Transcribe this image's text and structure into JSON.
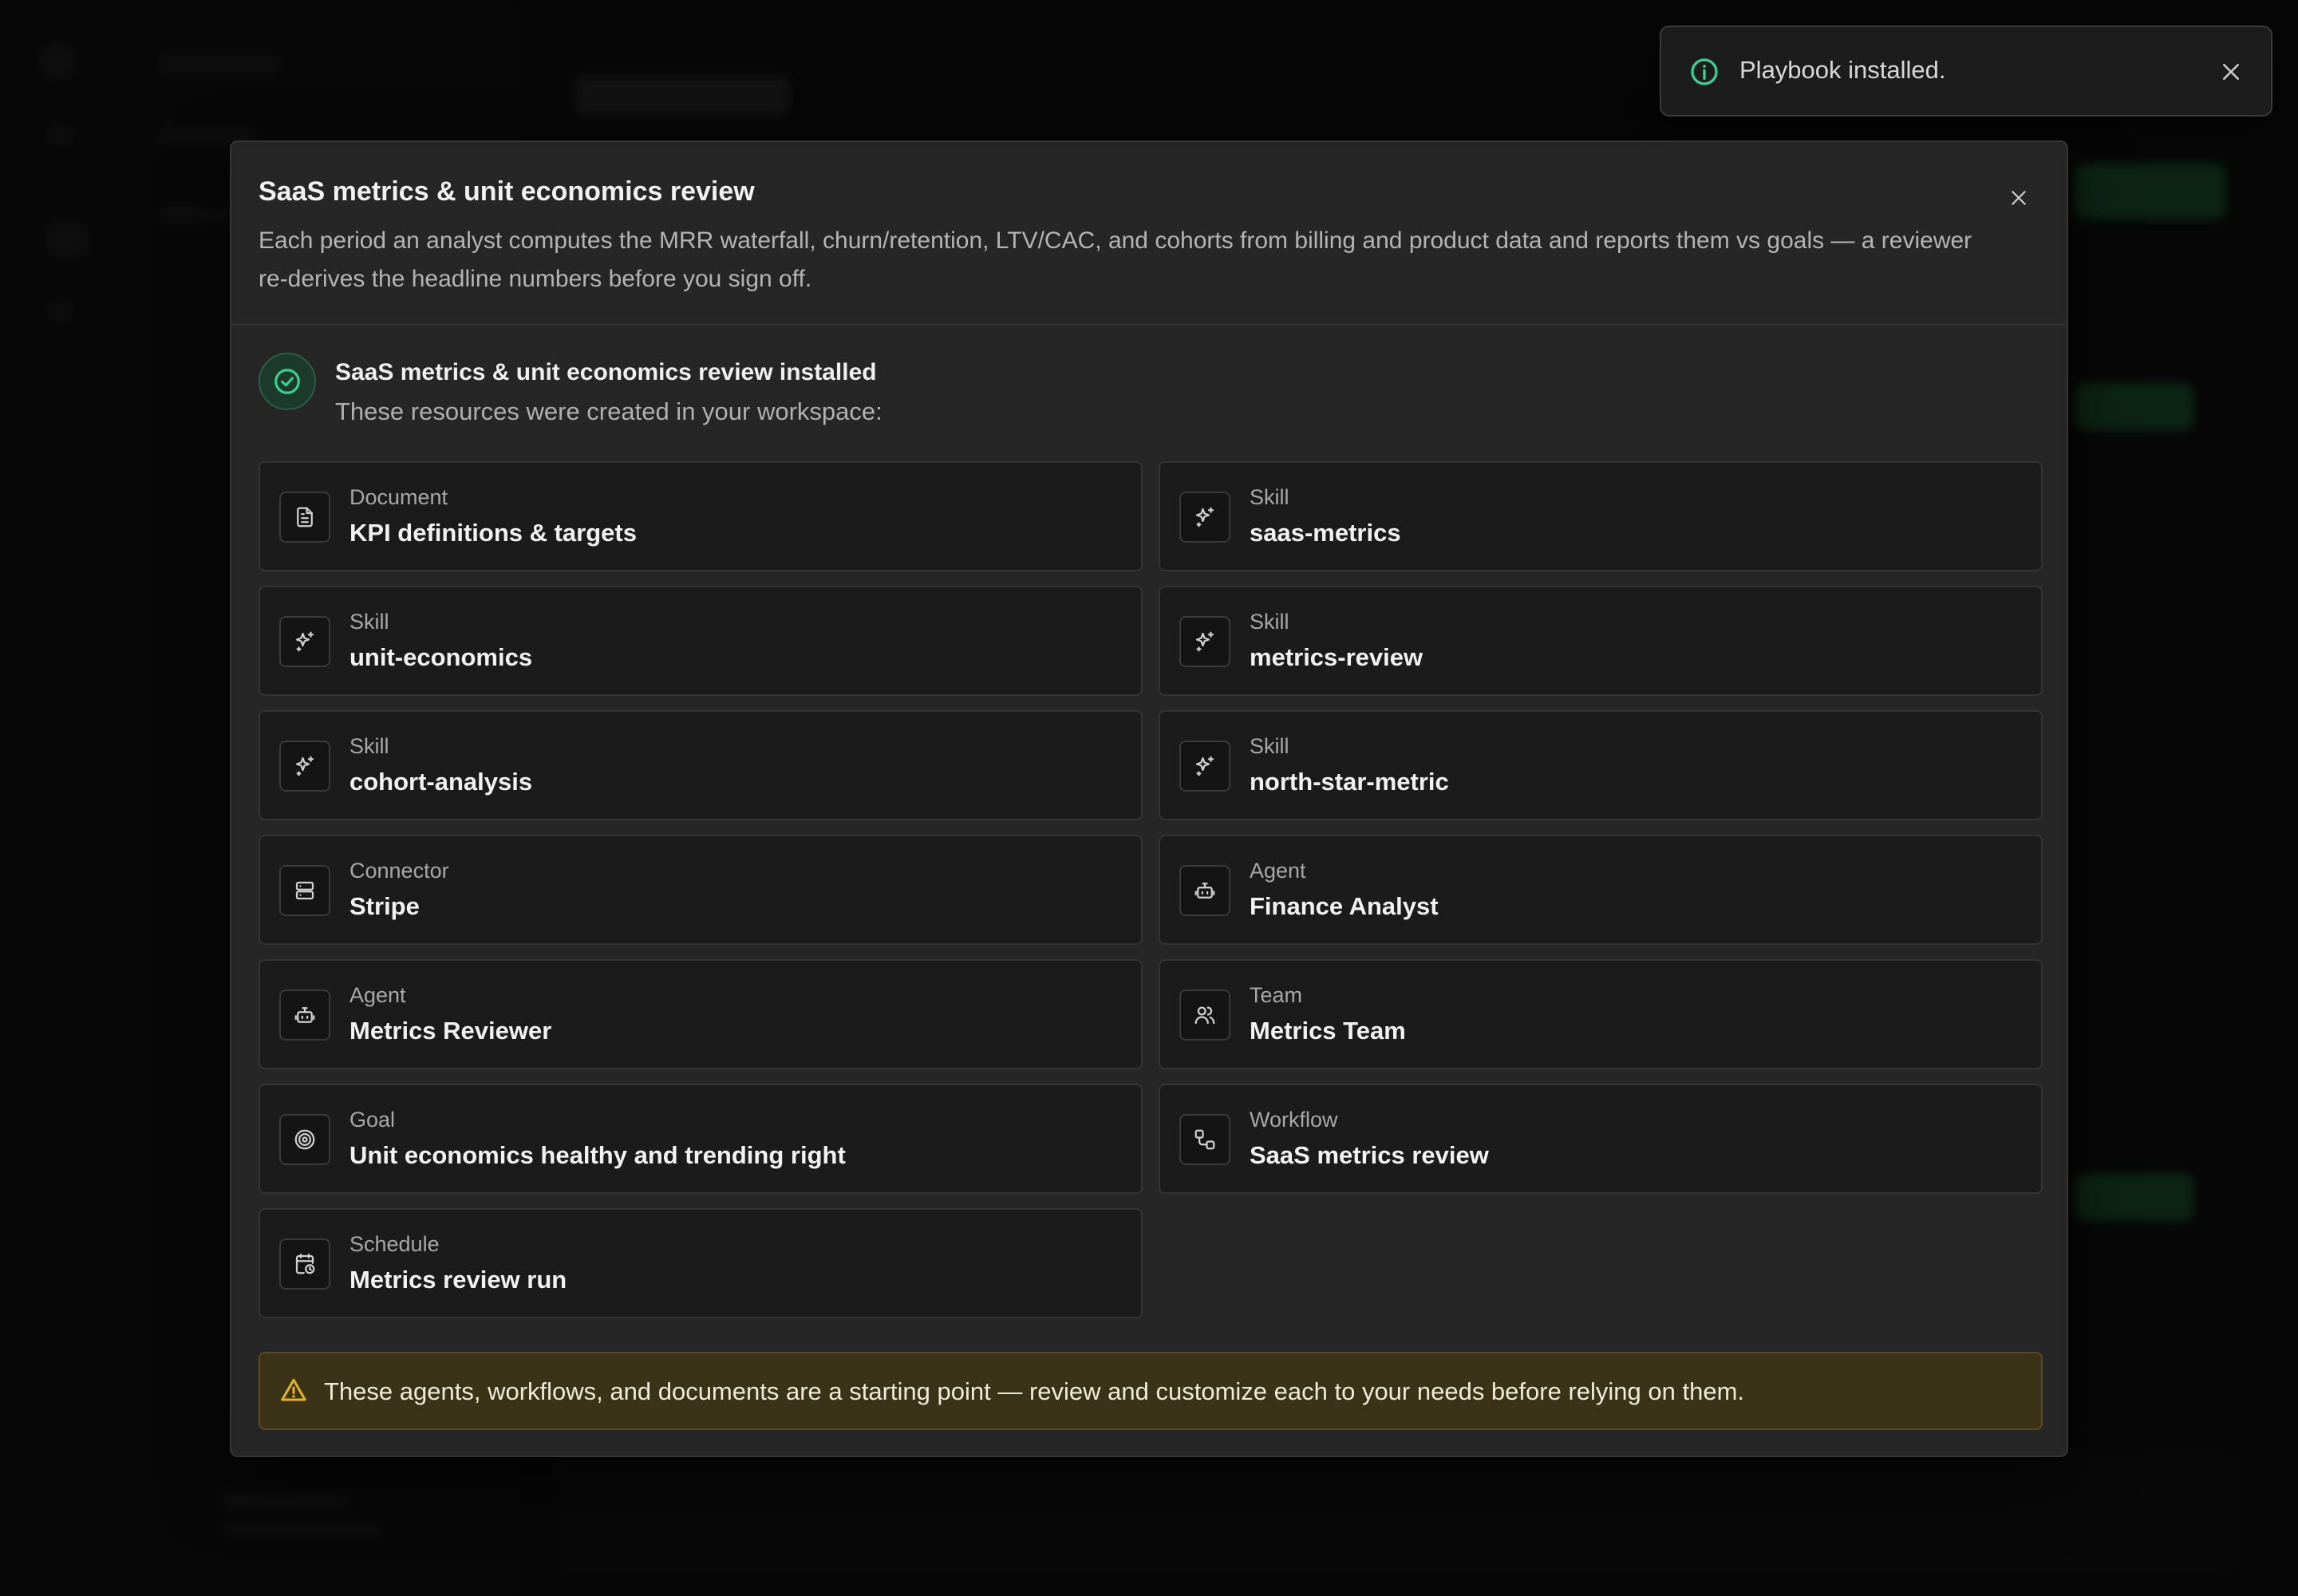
{
  "modal": {
    "title": "SaaS metrics & unit economics review",
    "description": "Each period an analyst computes the MRR waterfall, churn/retention, LTV/CAC, and cohorts from billing and product data and reports them vs goals — a reviewer re-derives the headline numbers before you sign off.",
    "close_icon": "close-icon"
  },
  "installed": {
    "title": "SaaS metrics & unit economics review installed",
    "subtitle": "These resources were created in your workspace:",
    "icon": "check-circle-icon",
    "accent_color": "#3ecf8e"
  },
  "resources": [
    {
      "type": "Document",
      "name": "KPI definitions & targets",
      "icon": "document-icon"
    },
    {
      "type": "Skill",
      "name": "saas-metrics",
      "icon": "sparkles-icon"
    },
    {
      "type": "Skill",
      "name": "unit-economics",
      "icon": "sparkles-icon"
    },
    {
      "type": "Skill",
      "name": "metrics-review",
      "icon": "sparkles-icon"
    },
    {
      "type": "Skill",
      "name": "cohort-analysis",
      "icon": "sparkles-icon"
    },
    {
      "type": "Skill",
      "name": "north-star-metric",
      "icon": "sparkles-icon"
    },
    {
      "type": "Connector",
      "name": "Stripe",
      "icon": "server-icon"
    },
    {
      "type": "Agent",
      "name": "Finance Analyst",
      "icon": "bot-icon"
    },
    {
      "type": "Agent",
      "name": "Metrics Reviewer",
      "icon": "bot-icon"
    },
    {
      "type": "Team",
      "name": "Metrics Team",
      "icon": "users-icon"
    },
    {
      "type": "Goal",
      "name": "Unit economics healthy and trending right",
      "icon": "target-icon"
    },
    {
      "type": "Workflow",
      "name": "SaaS metrics review",
      "icon": "workflow-icon"
    },
    {
      "type": "Schedule",
      "name": "Metrics review run",
      "icon": "calendar-clock-icon"
    }
  ],
  "warning": {
    "text": "These agents, workflows, and documents are a starting point — review and customize each to your needs before relying on them.",
    "icon": "warning-triangle-icon",
    "color": "#e6b422"
  },
  "toast": {
    "text": "Playbook installed.",
    "icon": "info-icon",
    "icon_color": "#3ecf8e",
    "close_icon": "close-icon"
  }
}
